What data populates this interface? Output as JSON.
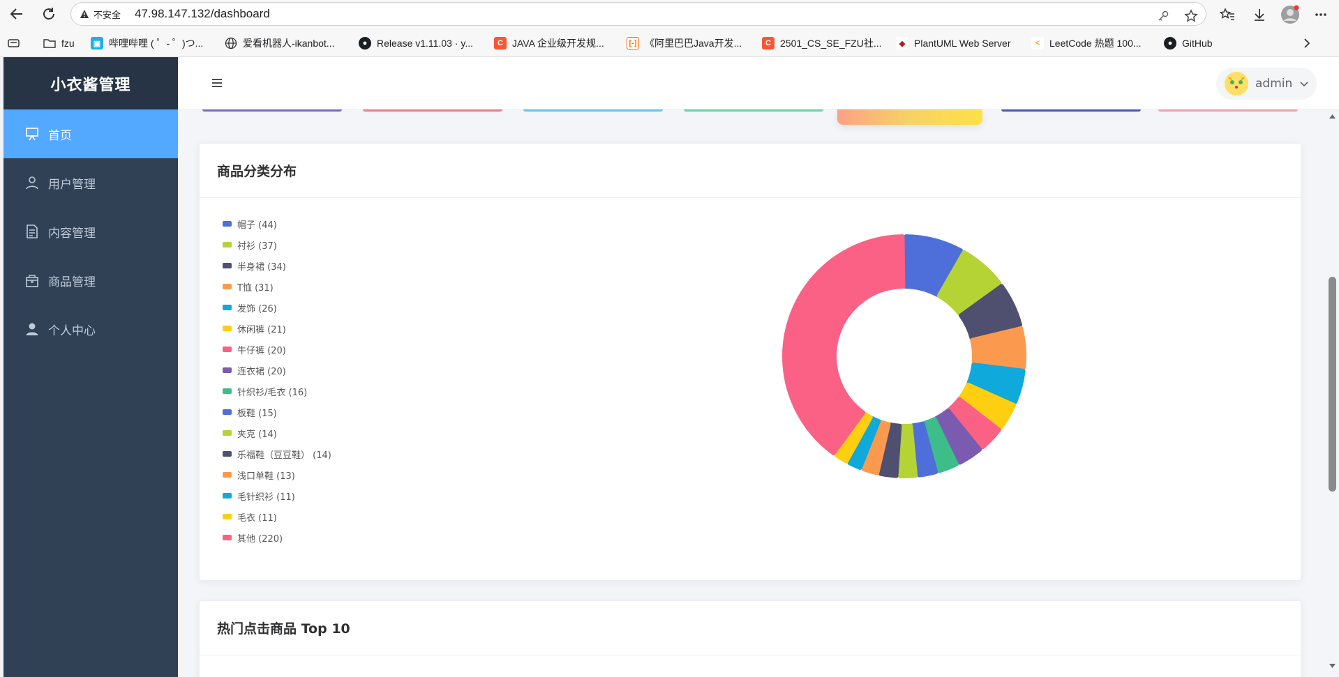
{
  "browser": {
    "security_label": "不安全",
    "url": "47.98.147.132/dashboard",
    "bookmarks": [
      {
        "label": "fzu",
        "icon": "folder-icon"
      },
      {
        "label": "哔哩哔哩 ( ゜- ゜)つ...",
        "icon": "bilibili-icon"
      },
      {
        "label": "爱看机器人-ikanbot...",
        "icon": "globe-icon"
      },
      {
        "label": "Release v1.11.03 · y...",
        "icon": "github-icon"
      },
      {
        "label": "JAVA 企业级开发规...",
        "icon": "csdn-icon"
      },
      {
        "label": "《阿里巴巴Java开发...",
        "icon": "aliyun-icon"
      },
      {
        "label": "2501_CS_SE_FZU社...",
        "icon": "csdn-icon"
      },
      {
        "label": "PlantUML Web Server",
        "icon": "plantuml-icon"
      },
      {
        "label": "LeetCode 热题 100...",
        "icon": "leetcode-icon"
      },
      {
        "label": "GitHub",
        "icon": "github-icon"
      }
    ]
  },
  "app": {
    "title": "小衣酱管理",
    "menu": [
      {
        "label": "首页",
        "icon": "monitor-icon",
        "active": true
      },
      {
        "label": "用户管理",
        "icon": "user-icon",
        "active": false
      },
      {
        "label": "内容管理",
        "icon": "document-icon",
        "active": false
      },
      {
        "label": "商品管理",
        "icon": "goods-icon",
        "active": false
      },
      {
        "label": "个人中心",
        "icon": "person-icon",
        "active": false
      }
    ],
    "user": {
      "name": "admin"
    }
  },
  "stat_strip_colors": [
    "#7b68c8",
    "#f27a8f",
    "#5ec8f0",
    "#67d6a8",
    "#f6c35b",
    "#4557b8",
    "#f4a0b0"
  ],
  "category_card": {
    "title": "商品分类分布"
  },
  "top_card": {
    "title": "热门点击商品 Top 10"
  },
  "chart_data": {
    "type": "pie",
    "variant": "donut",
    "legend_position": "left",
    "categories": [
      {
        "name": "帽子",
        "label": "帽子 (44)",
        "value": 44,
        "color": "#4e6fd9"
      },
      {
        "name": "衬衫",
        "label": "衬衫 (37)",
        "value": 37,
        "color": "#b5d334"
      },
      {
        "name": "半身裙",
        "label": "半身裙 (34)",
        "value": 34,
        "color": "#4f5070"
      },
      {
        "name": "T恤",
        "label": "T恤 (31)",
        "value": 31,
        "color": "#fb9a4e"
      },
      {
        "name": "发饰",
        "label": "发饰 (26)",
        "value": 26,
        "color": "#0fa9db"
      },
      {
        "name": "休闲裤",
        "label": "休闲裤 (21)",
        "value": 21,
        "color": "#fdcf10"
      },
      {
        "name": "牛仔裤",
        "label": "牛仔裤 (20)",
        "value": 20,
        "color": "#fb6085"
      },
      {
        "name": "连衣裙",
        "label": "连衣裙 (20)",
        "value": 20,
        "color": "#7b5bb0"
      },
      {
        "name": "针织衫/毛衣",
        "label": "针织衫/毛衣 (16)",
        "value": 16,
        "color": "#3dbd8a"
      },
      {
        "name": "板鞋",
        "label": "板鞋 (15)",
        "value": 15,
        "color": "#4e6fd9"
      },
      {
        "name": "夹克",
        "label": "夹克 (14)",
        "value": 14,
        "color": "#b5d334"
      },
      {
        "name": "乐福鞋（豆豆鞋）",
        "label": "乐福鞋（豆豆鞋） (14)",
        "value": 14,
        "color": "#4f5070"
      },
      {
        "name": "浅口单鞋",
        "label": "浅口单鞋 (13)",
        "value": 13,
        "color": "#fb9a4e"
      },
      {
        "name": "毛针织衫",
        "label": "毛针织衫 (11)",
        "value": 11,
        "color": "#0fa9db"
      },
      {
        "name": "毛衣",
        "label": "毛衣 (11)",
        "value": 11,
        "color": "#fdcf10"
      },
      {
        "name": "其他",
        "label": "其他 (220)",
        "value": 220,
        "color": "#fb6085"
      }
    ]
  }
}
